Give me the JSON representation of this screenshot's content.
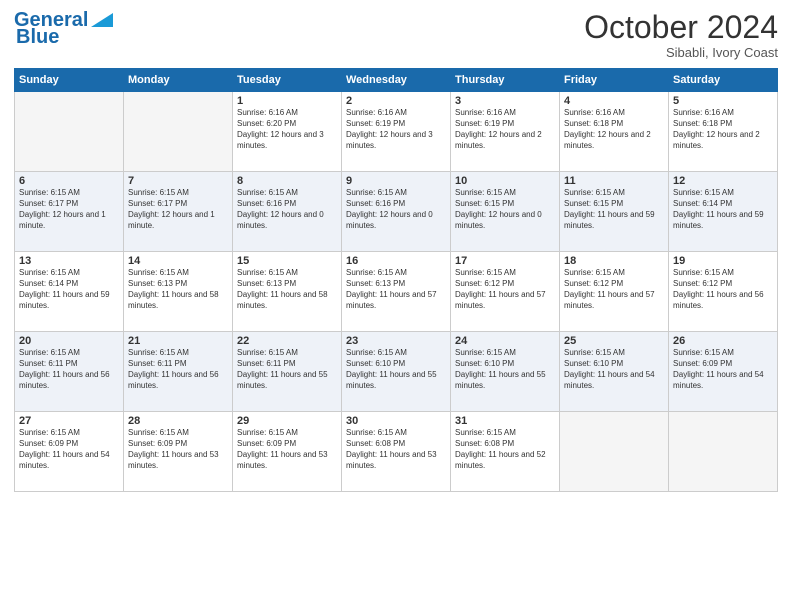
{
  "header": {
    "logo_line1": "General",
    "logo_line2": "Blue",
    "month_year": "October 2024",
    "location": "Sibabli, Ivory Coast"
  },
  "days_of_week": [
    "Sunday",
    "Monday",
    "Tuesday",
    "Wednesday",
    "Thursday",
    "Friday",
    "Saturday"
  ],
  "weeks": [
    [
      {
        "day": "",
        "info": ""
      },
      {
        "day": "",
        "info": ""
      },
      {
        "day": "1",
        "info": "Sunrise: 6:16 AM\nSunset: 6:20 PM\nDaylight: 12 hours and 3 minutes."
      },
      {
        "day": "2",
        "info": "Sunrise: 6:16 AM\nSunset: 6:19 PM\nDaylight: 12 hours and 3 minutes."
      },
      {
        "day": "3",
        "info": "Sunrise: 6:16 AM\nSunset: 6:19 PM\nDaylight: 12 hours and 2 minutes."
      },
      {
        "day": "4",
        "info": "Sunrise: 6:16 AM\nSunset: 6:18 PM\nDaylight: 12 hours and 2 minutes."
      },
      {
        "day": "5",
        "info": "Sunrise: 6:16 AM\nSunset: 6:18 PM\nDaylight: 12 hours and 2 minutes."
      }
    ],
    [
      {
        "day": "6",
        "info": "Sunrise: 6:15 AM\nSunset: 6:17 PM\nDaylight: 12 hours and 1 minute."
      },
      {
        "day": "7",
        "info": "Sunrise: 6:15 AM\nSunset: 6:17 PM\nDaylight: 12 hours and 1 minute."
      },
      {
        "day": "8",
        "info": "Sunrise: 6:15 AM\nSunset: 6:16 PM\nDaylight: 12 hours and 0 minutes."
      },
      {
        "day": "9",
        "info": "Sunrise: 6:15 AM\nSunset: 6:16 PM\nDaylight: 12 hours and 0 minutes."
      },
      {
        "day": "10",
        "info": "Sunrise: 6:15 AM\nSunset: 6:15 PM\nDaylight: 12 hours and 0 minutes."
      },
      {
        "day": "11",
        "info": "Sunrise: 6:15 AM\nSunset: 6:15 PM\nDaylight: 11 hours and 59 minutes."
      },
      {
        "day": "12",
        "info": "Sunrise: 6:15 AM\nSunset: 6:14 PM\nDaylight: 11 hours and 59 minutes."
      }
    ],
    [
      {
        "day": "13",
        "info": "Sunrise: 6:15 AM\nSunset: 6:14 PM\nDaylight: 11 hours and 59 minutes."
      },
      {
        "day": "14",
        "info": "Sunrise: 6:15 AM\nSunset: 6:13 PM\nDaylight: 11 hours and 58 minutes."
      },
      {
        "day": "15",
        "info": "Sunrise: 6:15 AM\nSunset: 6:13 PM\nDaylight: 11 hours and 58 minutes."
      },
      {
        "day": "16",
        "info": "Sunrise: 6:15 AM\nSunset: 6:13 PM\nDaylight: 11 hours and 57 minutes."
      },
      {
        "day": "17",
        "info": "Sunrise: 6:15 AM\nSunset: 6:12 PM\nDaylight: 11 hours and 57 minutes."
      },
      {
        "day": "18",
        "info": "Sunrise: 6:15 AM\nSunset: 6:12 PM\nDaylight: 11 hours and 57 minutes."
      },
      {
        "day": "19",
        "info": "Sunrise: 6:15 AM\nSunset: 6:12 PM\nDaylight: 11 hours and 56 minutes."
      }
    ],
    [
      {
        "day": "20",
        "info": "Sunrise: 6:15 AM\nSunset: 6:11 PM\nDaylight: 11 hours and 56 minutes."
      },
      {
        "day": "21",
        "info": "Sunrise: 6:15 AM\nSunset: 6:11 PM\nDaylight: 11 hours and 56 minutes."
      },
      {
        "day": "22",
        "info": "Sunrise: 6:15 AM\nSunset: 6:11 PM\nDaylight: 11 hours and 55 minutes."
      },
      {
        "day": "23",
        "info": "Sunrise: 6:15 AM\nSunset: 6:10 PM\nDaylight: 11 hours and 55 minutes."
      },
      {
        "day": "24",
        "info": "Sunrise: 6:15 AM\nSunset: 6:10 PM\nDaylight: 11 hours and 55 minutes."
      },
      {
        "day": "25",
        "info": "Sunrise: 6:15 AM\nSunset: 6:10 PM\nDaylight: 11 hours and 54 minutes."
      },
      {
        "day": "26",
        "info": "Sunrise: 6:15 AM\nSunset: 6:09 PM\nDaylight: 11 hours and 54 minutes."
      }
    ],
    [
      {
        "day": "27",
        "info": "Sunrise: 6:15 AM\nSunset: 6:09 PM\nDaylight: 11 hours and 54 minutes."
      },
      {
        "day": "28",
        "info": "Sunrise: 6:15 AM\nSunset: 6:09 PM\nDaylight: 11 hours and 53 minutes."
      },
      {
        "day": "29",
        "info": "Sunrise: 6:15 AM\nSunset: 6:09 PM\nDaylight: 11 hours and 53 minutes."
      },
      {
        "day": "30",
        "info": "Sunrise: 6:15 AM\nSunset: 6:08 PM\nDaylight: 11 hours and 53 minutes."
      },
      {
        "day": "31",
        "info": "Sunrise: 6:15 AM\nSunset: 6:08 PM\nDaylight: 11 hours and 52 minutes."
      },
      {
        "day": "",
        "info": ""
      },
      {
        "day": "",
        "info": ""
      }
    ]
  ]
}
